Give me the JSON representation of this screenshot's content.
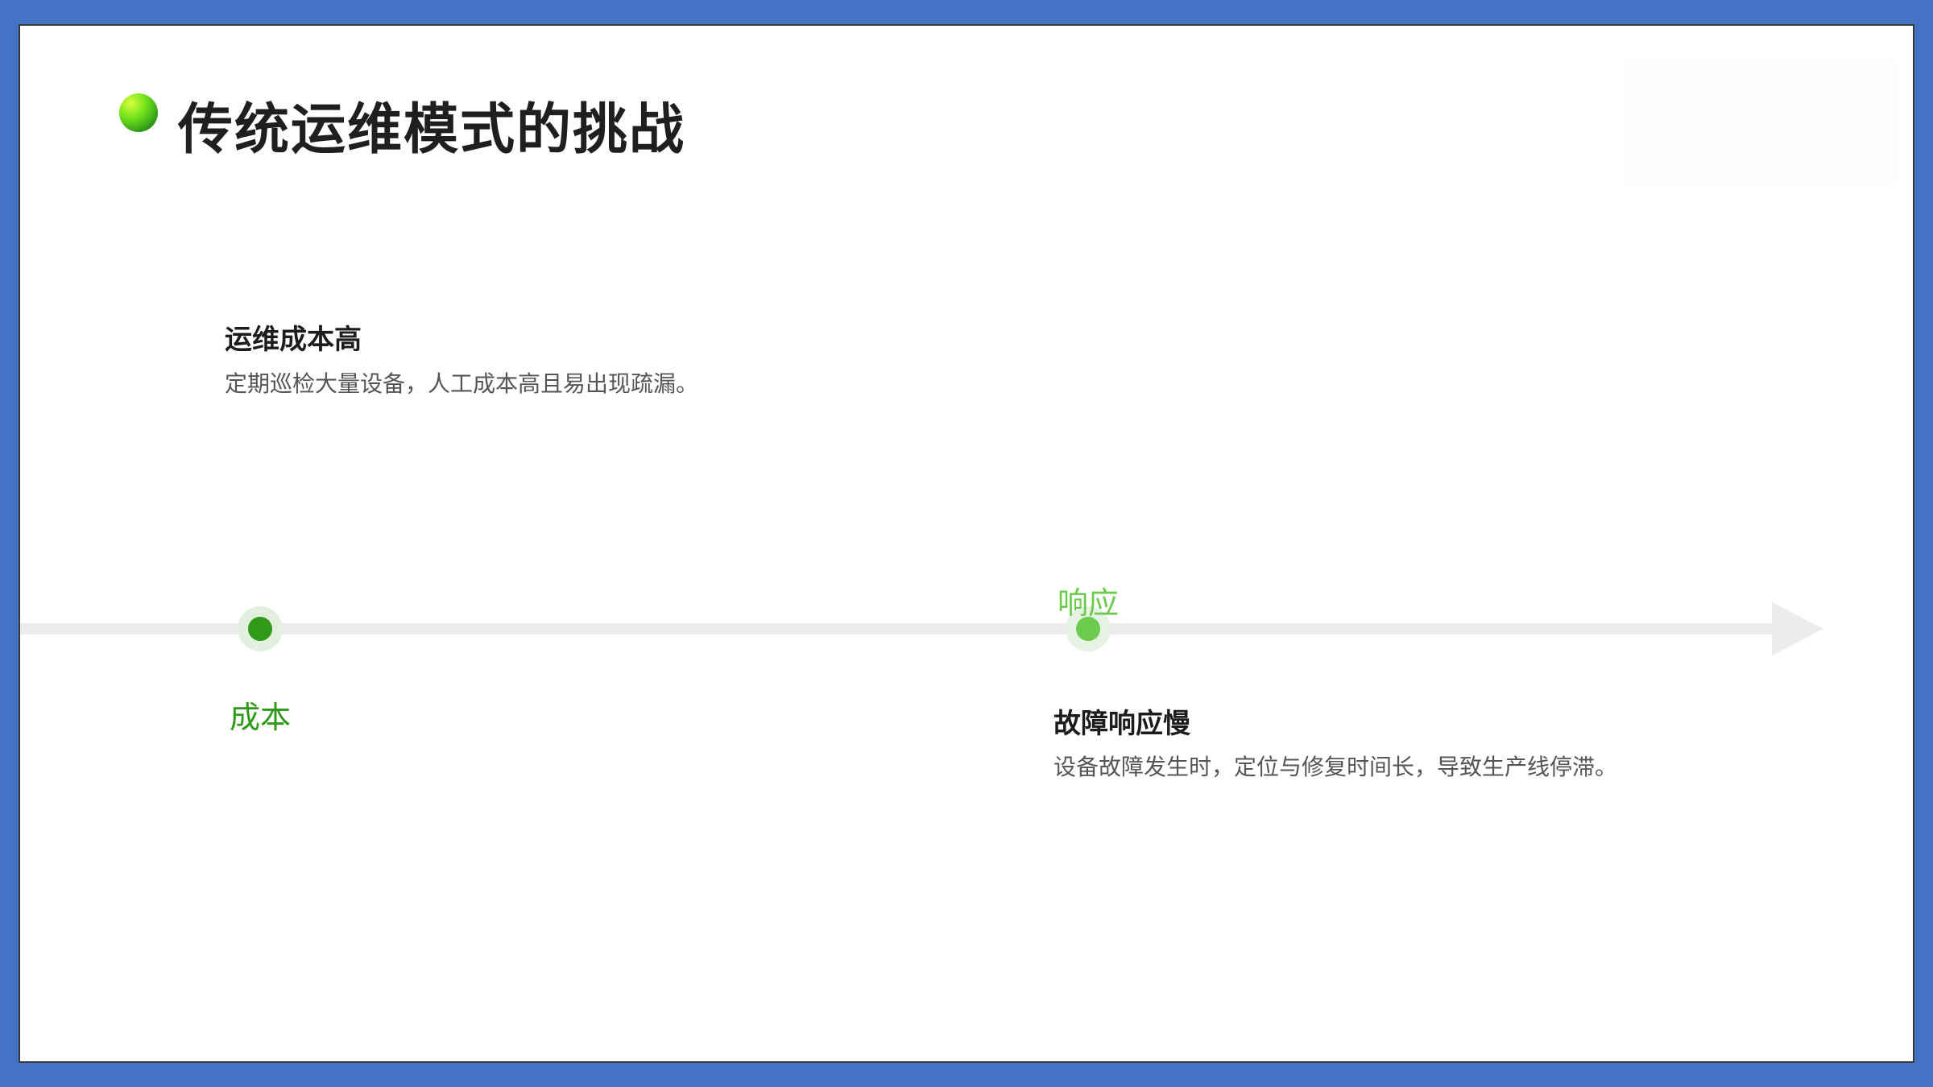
{
  "slide": {
    "title": "传统运维模式的挑战"
  },
  "timeline": {
    "nodes": [
      {
        "label": "成本",
        "title": "运维成本高",
        "description": "定期巡检大量设备，人工成本高且易出现疏漏。"
      },
      {
        "label": "响应",
        "title": "故障响应慢",
        "description": "设备故障发生时，定位与修复时间长，导致生产线停滞。"
      }
    ]
  },
  "colors": {
    "frame": "#4472c4",
    "node_1": "#2f9a18",
    "node_2": "#6cca4c",
    "timeline_track": "#ececec",
    "title_text": "#1f1f1f"
  }
}
